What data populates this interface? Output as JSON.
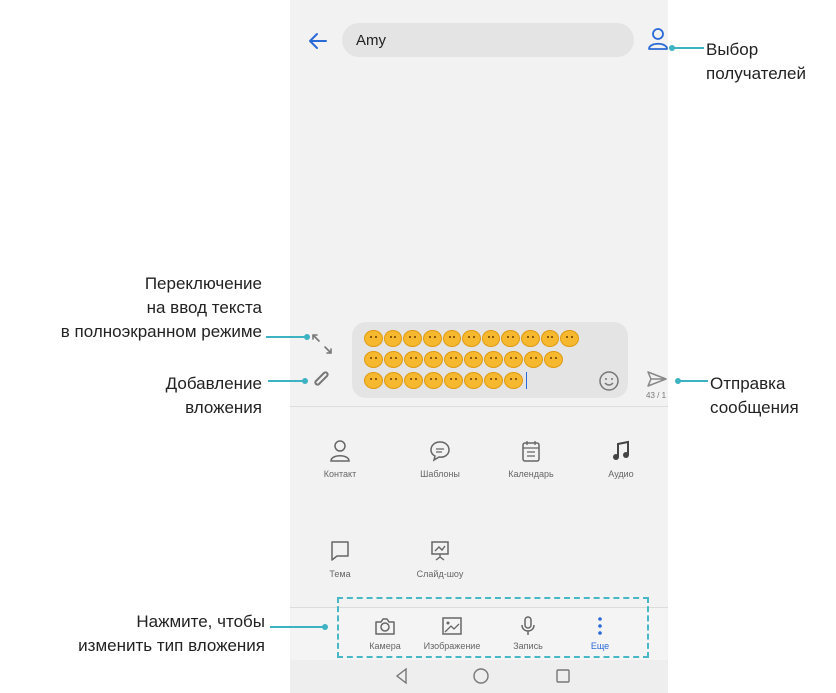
{
  "recipient": {
    "name": "Amy"
  },
  "composer": {
    "emoji_rows": [
      11,
      10,
      8
    ],
    "char_counter": "43 / 1"
  },
  "attachment_panel": {
    "row1": [
      {
        "label": "Контакт",
        "icon": "contact-icon"
      },
      {
        "label": "Шаблоны",
        "icon": "templates-icon"
      },
      {
        "label": "Календарь",
        "icon": "calendar-icon"
      },
      {
        "label": "Аудио",
        "icon": "music-icon"
      }
    ],
    "row2": [
      {
        "label": "Тема",
        "icon": "subject-icon"
      },
      {
        "label": "Слайд-шоу",
        "icon": "slideshow-icon"
      }
    ]
  },
  "tabs": [
    {
      "label": "Камера",
      "icon": "camera-icon"
    },
    {
      "label": "Изображение",
      "icon": "image-icon"
    },
    {
      "label": "Запись",
      "icon": "microphone-icon"
    },
    {
      "label": "Еще",
      "icon": "more-icon"
    }
  ],
  "callouts": {
    "recipients": "Выбор\nполучателей",
    "fullscreen": "Переключение\nна ввод текста\nв полноэкранном режиме",
    "attachment": "Добавление\nвложения",
    "send": "Отправка\nсообщения",
    "change_type": "Нажмите, чтобы\nизменить тип вложения"
  },
  "colors": {
    "accent": "#2a6ad6",
    "leader": "#3db2c2",
    "emoji": "#f5b82e"
  }
}
